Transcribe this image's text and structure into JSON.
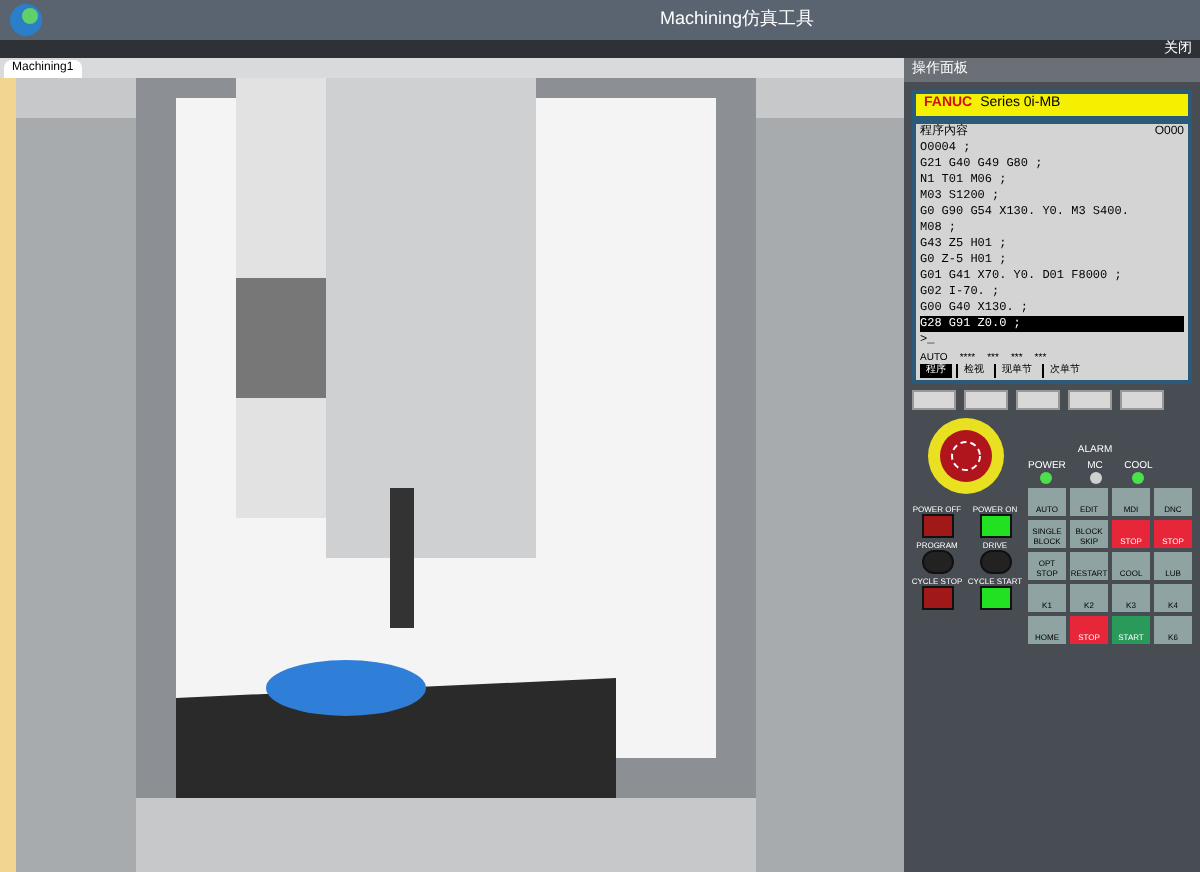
{
  "window": {
    "title": "Machining仿真工具",
    "close_label": "关闭"
  },
  "tabs": [
    {
      "label": "Machining1",
      "selected": true
    }
  ],
  "panel": {
    "title": "操作面板",
    "brand": "FANUC",
    "series": "Series 0i-MB",
    "screen": {
      "heading": "程序內容",
      "program": "O000",
      "lines": [
        {
          "text": "O0004 ;",
          "selected": false
        },
        {
          "text": "G21 G40 G49 G80 ;",
          "selected": false
        },
        {
          "text": "N1 T01 M06 ;",
          "selected": false
        },
        {
          "text": "M03 S1200 ;",
          "selected": false
        },
        {
          "text": "G0 G90 G54 X130. Y0. M3 S400.",
          "selected": false
        },
        {
          "text": "M08 ;",
          "selected": false
        },
        {
          "text": "G43 Z5 H01 ;",
          "selected": false
        },
        {
          "text": "G0 Z-5 H01 ;",
          "selected": false
        },
        {
          "text": "G01 G41 X70. Y0. D01 F8000 ;",
          "selected": false
        },
        {
          "text": "G02 I-70. ;",
          "selected": false
        },
        {
          "text": "G00 G40 X130. ;",
          "selected": false
        },
        {
          "text": "G28 G91 Z0.0 ;",
          "selected": true
        }
      ],
      "prompt": ">_",
      "mode": "AUTO",
      "status": [
        "****",
        "***",
        "***",
        "***"
      ],
      "softkeys": [
        {
          "label": "程序",
          "selected": true
        },
        {
          "label": "检视",
          "selected": false
        },
        {
          "label": "现单节",
          "selected": false
        },
        {
          "label": "次单节",
          "selected": false
        }
      ]
    },
    "lamps": [
      {
        "label": "POWER",
        "on": true
      },
      {
        "label": "MC",
        "on": false
      },
      {
        "label": "COOL",
        "on": true
      }
    ],
    "alarm_label": "ALARM",
    "buttons": [
      {
        "label": "POWER OFF",
        "kind": "red"
      },
      {
        "label": "POWER ON",
        "kind": "green"
      },
      {
        "label": "PROGRAM",
        "kind": "knob"
      },
      {
        "label": "DRIVE",
        "kind": "knob"
      },
      {
        "label": "CYCLE STOP",
        "kind": "red"
      },
      {
        "label": "CYCLE START",
        "kind": "green"
      }
    ],
    "keys": [
      {
        "label": "AUTO",
        "kind": "gray"
      },
      {
        "label": "EDIT",
        "kind": "gray"
      },
      {
        "label": "MDI",
        "kind": "gray"
      },
      {
        "label": "DNC",
        "kind": "gray"
      },
      {
        "label": "SINGLE BLOCK",
        "kind": "gray"
      },
      {
        "label": "BLOCK SKIP",
        "kind": "gray"
      },
      {
        "label": "STOP",
        "kind": "red"
      },
      {
        "label": "STOP",
        "kind": "red"
      },
      {
        "label": "OPT STOP",
        "kind": "gray"
      },
      {
        "label": "RESTART",
        "kind": "gray"
      },
      {
        "label": "COOL",
        "kind": "gray"
      },
      {
        "label": "LUB",
        "kind": "gray"
      },
      {
        "label": "K1",
        "kind": "gray"
      },
      {
        "label": "K2",
        "kind": "gray"
      },
      {
        "label": "K3",
        "kind": "gray"
      },
      {
        "label": "K4",
        "kind": "gray"
      },
      {
        "label": "HOME",
        "kind": "gray"
      },
      {
        "label": "STOP",
        "kind": "red"
      },
      {
        "label": "START",
        "kind": "green"
      },
      {
        "label": "K6",
        "kind": "gray"
      }
    ]
  }
}
